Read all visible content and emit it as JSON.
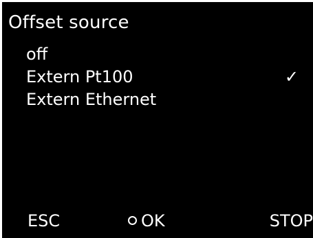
{
  "screen": {
    "title": "Offset source",
    "background_color": "#000000",
    "text_color": "#ffffff"
  },
  "menu": {
    "items": [
      {
        "label": "off",
        "selected": false,
        "check": ""
      },
      {
        "label": "Extern Pt100",
        "selected": true,
        "check": "✓"
      },
      {
        "label": "Extern Ethernet",
        "selected": false,
        "check": ""
      }
    ]
  },
  "softkeys": {
    "esc_label": "ESC",
    "ok_label": "OK",
    "ok_icon": "circle-icon",
    "stop_label": "STOP"
  }
}
